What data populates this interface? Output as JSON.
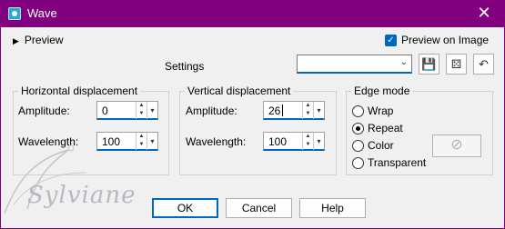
{
  "window": {
    "title": "Wave",
    "close_label": "✕"
  },
  "preview": {
    "label": "Preview",
    "toggle_icon": "triangle-right-icon"
  },
  "preview_on_image": {
    "label": "Preview on Image",
    "checked": true
  },
  "settings": {
    "label": "Settings",
    "value": ""
  },
  "horizontal": {
    "legend": "Horizontal displacement",
    "amplitude_label": "Amplitude:",
    "amplitude_value": "0",
    "wavelength_label": "Wavelength:",
    "wavelength_value": "100"
  },
  "vertical": {
    "legend": "Vertical displacement",
    "amplitude_label": "Amplitude:",
    "amplitude_value": "26",
    "wavelength_label": "Wavelength:",
    "wavelength_value": "100"
  },
  "edge_mode": {
    "legend": "Edge mode",
    "options": [
      "Wrap",
      "Repeat",
      "Color",
      "Transparent"
    ],
    "selected": "Repeat"
  },
  "buttons": {
    "ok": "OK",
    "cancel": "Cancel",
    "help": "Help"
  },
  "watermark": "Sylviane",
  "colors": {
    "titlebar": "#800080",
    "accent": "#0067c0"
  }
}
